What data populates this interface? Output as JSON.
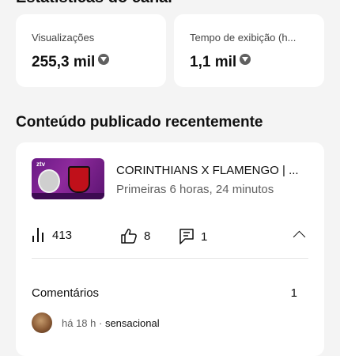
{
  "top_heading": "Estatísticas do canal",
  "stats": [
    {
      "label": "Visualizações",
      "value": "255,3 mil",
      "trend_icon": "arrow-down-circle-icon"
    },
    {
      "label": "Tempo de exibição (h...",
      "value": "1,1 mil",
      "trend_icon": "arrow-down-circle-icon"
    }
  ],
  "section_title": "Conteúdo publicado recentemente",
  "video": {
    "title": "CORINTHIANS X FLAMENGO | ...",
    "subtitle": "Primeiras 6 horas, 24 minutos",
    "thumbnail_logo": "ztv"
  },
  "metrics": {
    "views": "413",
    "likes": "8",
    "comments": "1"
  },
  "comments_section": {
    "label": "Comentários",
    "count": "1",
    "latest": {
      "time": "há 18 h",
      "separator": " · ",
      "text": "sensacional"
    }
  },
  "colors": {
    "background": "#f4f4f4",
    "card": "#ffffff",
    "text_primary": "#0f0f0f",
    "text_secondary": "#606060"
  }
}
